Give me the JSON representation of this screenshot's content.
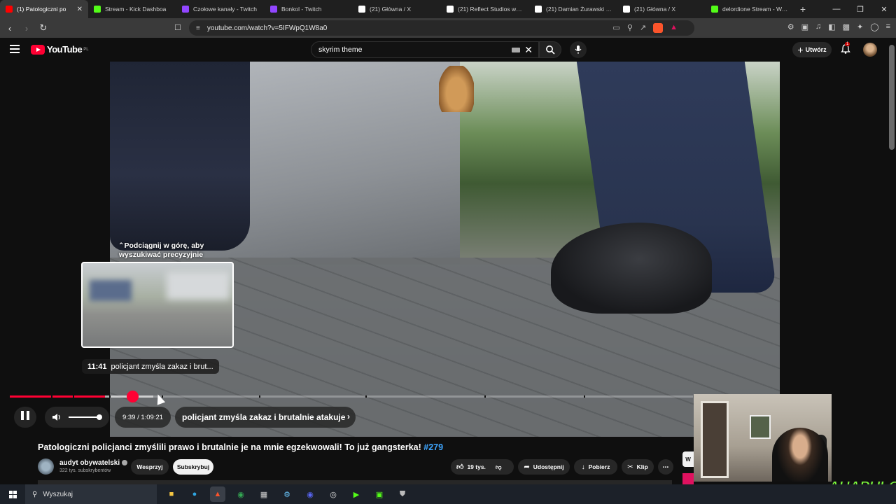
{
  "browser": {
    "tabs": [
      {
        "title": "(1) Patologiczni po",
        "color": "#ff0000",
        "active": true
      },
      {
        "title": "Stream - Kick Dashboa",
        "color": "#53fc18",
        "active": false
      },
      {
        "title": "Czołowe kanały - Twitch",
        "color": "#9146ff",
        "active": false
      },
      {
        "title": "Bonkol - Twitch",
        "color": "#9146ff",
        "active": false
      },
      {
        "title": "(21) Główna / X",
        "color": "#ffffff",
        "active": false
      },
      {
        "title": "(21) Reflect Studios w serw",
        "color": "#ffffff",
        "active": false
      },
      {
        "title": "(21) Damian Żurawski w sc",
        "color": "#ffffff",
        "active": false
      },
      {
        "title": "(21) Główna / X",
        "color": "#ffffff",
        "active": false
      },
      {
        "title": "delordione Stream - Watc",
        "color": "#53fc18",
        "active": false
      }
    ],
    "url": "youtube.com/watch?v=5IFWpQ1W8a0"
  },
  "youtube": {
    "logo_text": "YouTube",
    "region": "PL",
    "search_value": "skyrim theme",
    "create_label": "Utwórz",
    "notifications": "1"
  },
  "player": {
    "scrub_hint": "Podciągnij w górę, aby wyszukiwać precyzyjnie",
    "preview_time": "11:41",
    "preview_chapter": "policjant zmyśla zakaz i brut...",
    "current_time": "9:39",
    "duration": "1:09:21",
    "time_display": "9:39 / 1:09:21",
    "chapter": "policjant zmyśla zakaz i brutalnie atakuje",
    "played_fraction": 0.139,
    "buffered_fraction": 0.21,
    "volume_fraction": 0.9,
    "chapter_marks": [
      0.06,
      0.092,
      0.145,
      0.222,
      0.365,
      0.52,
      0.695,
      0.84
    ]
  },
  "video": {
    "title": "Patologiczni policjanci zmyślili prawo i brutalnie je na mnie egzekwowali! To już gangsterka!",
    "hashtag": "#279",
    "channel": "audyt obywatelski",
    "subscribers": "322 tys. subskrybentów",
    "support_label": "Wesprzyj",
    "subscribe_label": "Subskrybuj",
    "likes": "19 tys.",
    "share_label": "Udostępnij",
    "download_label": "Pobierz",
    "clip_label": "Klip",
    "side_label": "W"
  },
  "overlay": {
    "logo_text": "AHAPULCO"
  },
  "taskbar": {
    "search_placeholder": "Wyszukaj"
  }
}
